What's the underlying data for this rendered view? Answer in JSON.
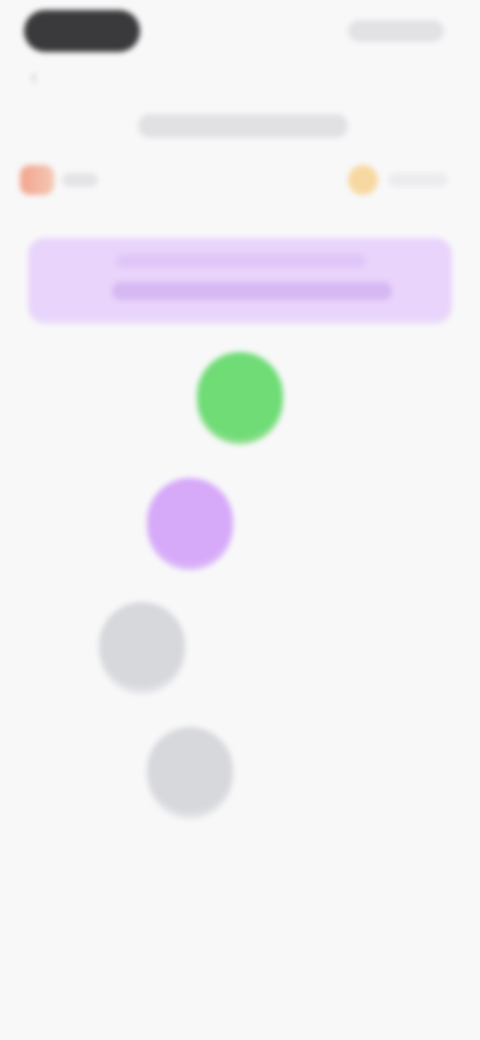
{
  "status_bar": {
    "time": "",
    "indicators": [
      "signal-icon",
      "wifi-icon",
      "battery-icon"
    ]
  },
  "header": {
    "back_icon": "chevron-left-icon",
    "title": "",
    "left_stat": {
      "icon": "flag-icon",
      "value": ""
    },
    "right_stat": {
      "icon": "streak-icon",
      "value": ""
    }
  },
  "unit_banner": {
    "title": "",
    "subtitle": "",
    "color": "#e9d4fb"
  },
  "path": {
    "nodes": [
      {
        "state": "complete",
        "color": "#6fdc76"
      },
      {
        "state": "current",
        "color": "#d6a9f9"
      },
      {
        "state": "locked",
        "color": "#d7d8dc"
      },
      {
        "state": "locked",
        "color": "#d7d8dc"
      }
    ]
  }
}
